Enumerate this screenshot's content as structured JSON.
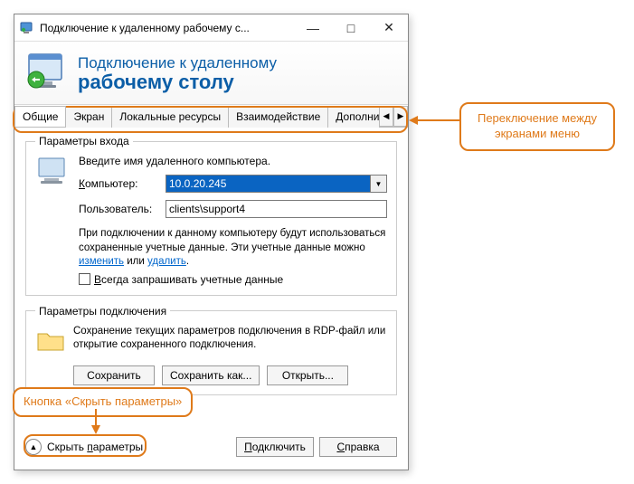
{
  "titlebar": {
    "title": "Подключение к удаленному рабочему с..."
  },
  "header": {
    "line1": "Подключение к удаленному",
    "line2": "рабочему столу"
  },
  "tabs": {
    "items": [
      {
        "label": "Общие"
      },
      {
        "label": "Экран"
      },
      {
        "label": "Локальные ресурсы"
      },
      {
        "label": "Взаимодействие"
      },
      {
        "label": "Дополни"
      }
    ]
  },
  "login": {
    "legend": "Параметры входа",
    "intro": "Введите имя удаленного компьютера.",
    "computer_label_pre": "К",
    "computer_label_rest": "омпьютер:",
    "computer_value": "10.0.20.245",
    "user_label": "Пользователь:",
    "user_value": "clients\\support4",
    "note_pre": "При подключении к данному компьютеру будут использоваться сохраненные учетные данные.  Эти учетные данные можно ",
    "note_link1": "изменить",
    "note_mid": " или ",
    "note_link2": "удалить",
    "note_post": ".",
    "checkbox_pre": "В",
    "checkbox_rest": "сегда запрашивать учетные данные"
  },
  "conn": {
    "legend": "Параметры подключения",
    "text": "Сохранение текущих параметров подключения в RDP-файл или открытие сохраненного подключения.",
    "save": "Сохранить",
    "saveas": "Сохранить как...",
    "open": "Открыть..."
  },
  "footer": {
    "collapse_pre": "Скрыть ",
    "collapse_under": "п",
    "collapse_rest": "араметры",
    "connect_pre": "П",
    "connect_rest": "одключить",
    "help_pre": "С",
    "help_rest": "правка"
  },
  "annotations": {
    "tabs_callout": "Переключение между экранами меню",
    "hide_callout": "Кнопка «Скрыть параметры»"
  }
}
